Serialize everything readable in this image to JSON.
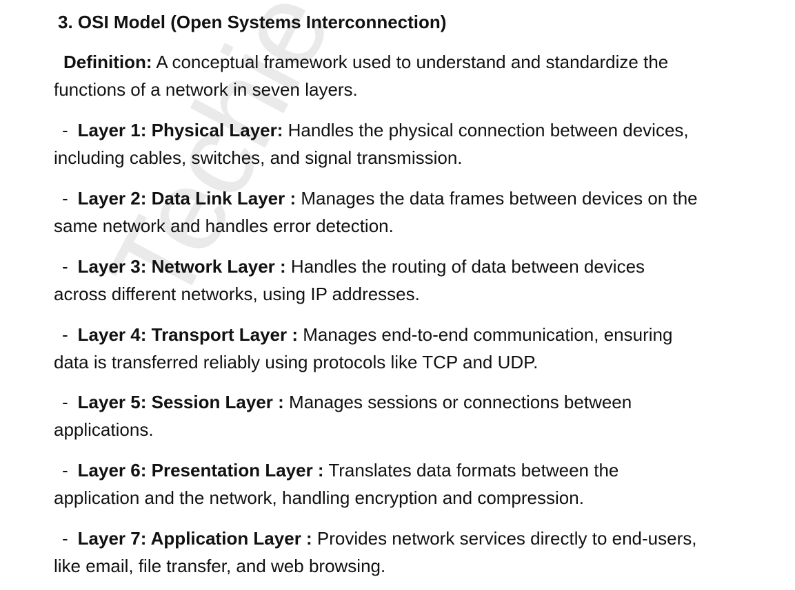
{
  "watermark": "Techie CodeBuddy",
  "heading": "3. OSI Model (Open Systems Interconnection)",
  "definition": {
    "label": "Definition:",
    "line1": " A conceptual framework used to understand and standardize the",
    "line2": "functions of a network in seven layers."
  },
  "layers": [
    {
      "dash": "-",
      "label": "Layer 1: Physical Layer:",
      "line1": " Handles the physical connection between devices,",
      "line2": "including cables, switches, and signal transmission."
    },
    {
      "dash": "-",
      "label": "Layer 2: Data Link Layer :",
      "line1": " Manages the data frames between devices on the",
      "line2": "same network and handles error detection."
    },
    {
      "dash": "-",
      "label": "Layer 3: Network Layer :",
      "line1": " Handles the routing of data between devices",
      "line2": "across different networks, using IP addresses."
    },
    {
      "dash": "-",
      "label": "Layer 4: Transport Layer :",
      "line1": " Manages end-to-end communication, ensuring",
      "line2": "data is transferred reliably using protocols like TCP and UDP."
    },
    {
      "dash": "-",
      "label": "Layer 5: Session Layer :",
      "line1": " Manages sessions or connections between",
      "line2": "applications."
    },
    {
      "dash": "-",
      "label": "Layer 6: Presentation Layer :",
      "line1": " Translates data formats between the",
      "line2": "application and the network, handling encryption and compression."
    },
    {
      "dash": "-",
      "label": "Layer 7: Application Layer :",
      "line1": " Provides network services directly to end-users,",
      "line2": "like email, file transfer, and web browsing."
    }
  ]
}
